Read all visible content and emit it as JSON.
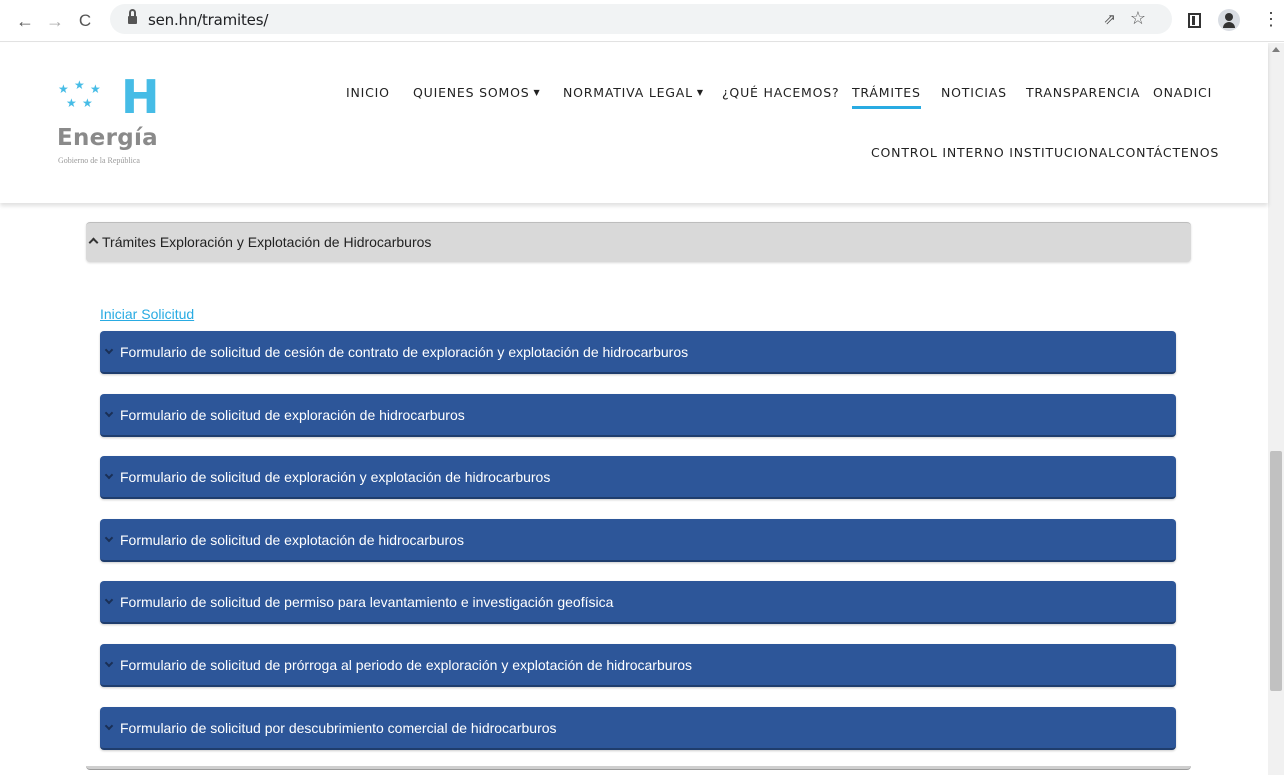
{
  "browser": {
    "back_icon": "←",
    "forward_icon": "→",
    "reload_icon": "C",
    "url": "sen.hn/tramites/",
    "share_icon": "⇗",
    "star_icon": "☆",
    "menu_icon": "⋮"
  },
  "logo": {
    "letter": "H",
    "word": "Energía",
    "subtitle": "Gobierno de la República",
    "color": "#46bce6"
  },
  "nav": {
    "items": [
      {
        "label": "INICIO"
      },
      {
        "label": "QUIENES SOMOS",
        "caret": "▼"
      },
      {
        "label": "NORMATIVA LEGAL",
        "caret": "▼"
      },
      {
        "label": "¿QUÉ HACEMOS?"
      },
      {
        "label": "TRÁMITES",
        "active": true
      },
      {
        "label": "NOTICIAS"
      },
      {
        "label": "TRANSPARENCIA"
      },
      {
        "label": "ONADICI"
      },
      {
        "label": "CONTROL INTERNO INSTITUCIONAL"
      },
      {
        "label": "CONTÁCTENOS"
      }
    ],
    "active_color": "#29abe2"
  },
  "section": {
    "title": "Trámites Exploración y Explotación de Hidrocarburos",
    "start_link": "Iniciar Solicitud",
    "forms": [
      "Formulario de solicitud de cesión de contrato de exploración y explotación de hidrocarburos",
      "Formulario de solicitud de exploración de hidrocarburos",
      "Formulario de solicitud de exploración y explotación de hidrocarburos",
      "Formulario de solicitud de explotación de hidrocarburos",
      "Formulario de solicitud de permiso para levantamiento e investigación geofísica",
      "Formulario de solicitud de prórroga al periodo de exploración y explotación de hidrocarburos",
      "Formulario de solicitud por descubrimiento comercial de hidrocarburos"
    ],
    "form_color": "#2d5699",
    "link_color": "#29abe2"
  }
}
